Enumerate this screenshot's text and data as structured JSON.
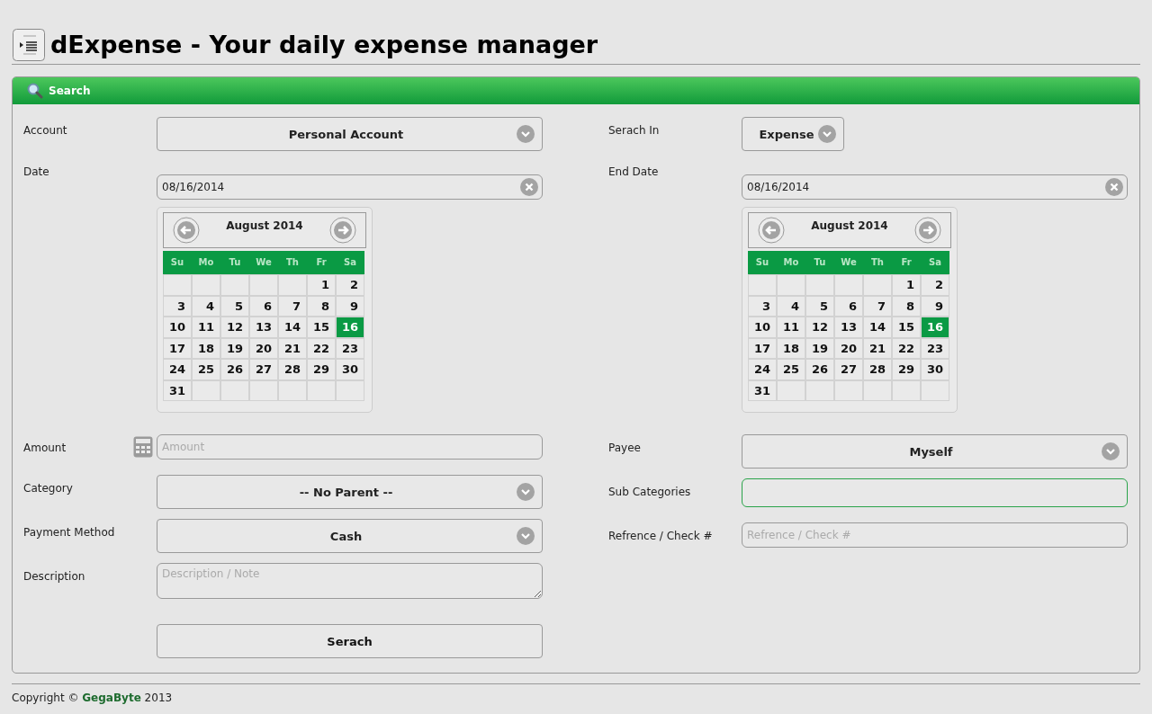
{
  "app": {
    "title": "dExpense - Your daily expense manager"
  },
  "panel": {
    "title": "Search"
  },
  "columns": [
    {
      "fields": [
        {
          "kind": "select",
          "label": "Account",
          "value": "Personal Account",
          "compact": false
        },
        {
          "kind": "date",
          "label": "Date",
          "value": "08/16/2014",
          "calendar": {
            "month": "August 2014",
            "weekdays": [
              "Su",
              "Mo",
              "Tu",
              "We",
              "Th",
              "Fr",
              "Sa"
            ],
            "weeks": [
              [
                {
                  "kind": "blank"
                },
                {
                  "kind": "blank"
                },
                {
                  "kind": "blank"
                },
                {
                  "kind": "blank"
                },
                {
                  "kind": "blank"
                },
                {
                  "kind": "day",
                  "day": "1",
                  "selected": false
                },
                {
                  "kind": "day",
                  "day": "2",
                  "selected": false
                }
              ],
              [
                {
                  "kind": "day",
                  "day": "3",
                  "selected": false
                },
                {
                  "kind": "day",
                  "day": "4",
                  "selected": false
                },
                {
                  "kind": "day",
                  "day": "5",
                  "selected": false
                },
                {
                  "kind": "day",
                  "day": "6",
                  "selected": false
                },
                {
                  "kind": "day",
                  "day": "7",
                  "selected": false
                },
                {
                  "kind": "day",
                  "day": "8",
                  "selected": false
                },
                {
                  "kind": "day",
                  "day": "9",
                  "selected": false
                }
              ],
              [
                {
                  "kind": "day",
                  "day": "10",
                  "selected": false
                },
                {
                  "kind": "day",
                  "day": "11",
                  "selected": false
                },
                {
                  "kind": "day",
                  "day": "12",
                  "selected": false
                },
                {
                  "kind": "day",
                  "day": "13",
                  "selected": false
                },
                {
                  "kind": "day",
                  "day": "14",
                  "selected": false
                },
                {
                  "kind": "day",
                  "day": "15",
                  "selected": false
                },
                {
                  "kind": "day",
                  "day": "16",
                  "selected": true
                }
              ],
              [
                {
                  "kind": "day",
                  "day": "17",
                  "selected": false
                },
                {
                  "kind": "day",
                  "day": "18",
                  "selected": false
                },
                {
                  "kind": "day",
                  "day": "19",
                  "selected": false
                },
                {
                  "kind": "day",
                  "day": "20",
                  "selected": false
                },
                {
                  "kind": "day",
                  "day": "21",
                  "selected": false
                },
                {
                  "kind": "day",
                  "day": "22",
                  "selected": false
                },
                {
                  "kind": "day",
                  "day": "23",
                  "selected": false
                }
              ],
              [
                {
                  "kind": "day",
                  "day": "24",
                  "selected": false
                },
                {
                  "kind": "day",
                  "day": "25",
                  "selected": false
                },
                {
                  "kind": "day",
                  "day": "26",
                  "selected": false
                },
                {
                  "kind": "day",
                  "day": "27",
                  "selected": false
                },
                {
                  "kind": "day",
                  "day": "28",
                  "selected": false
                },
                {
                  "kind": "day",
                  "day": "29",
                  "selected": false
                },
                {
                  "kind": "day",
                  "day": "30",
                  "selected": false
                }
              ],
              [
                {
                  "kind": "day",
                  "day": "31",
                  "selected": false
                },
                {
                  "kind": "blank"
                },
                {
                  "kind": "blank"
                },
                {
                  "kind": "blank"
                },
                {
                  "kind": "blank"
                },
                {
                  "kind": "blank"
                },
                {
                  "kind": "blank"
                }
              ]
            ]
          }
        },
        {
          "kind": "calc-input",
          "label": "Amount",
          "placeholder": "Amount",
          "focused": false
        },
        {
          "kind": "select",
          "label": "Category",
          "value": "-- No Parent --",
          "compact": false
        },
        {
          "kind": "select",
          "label": "Payment Method",
          "value": "Cash",
          "compact": false
        },
        {
          "kind": "textarea",
          "label": "Description",
          "placeholder": "Description / Note"
        },
        {
          "kind": "button",
          "value": "Serach"
        }
      ]
    },
    {
      "fields": [
        {
          "kind": "select",
          "label": "Serach In",
          "value": "Expense",
          "compact": true
        },
        {
          "kind": "date",
          "label": "End Date",
          "value": "08/16/2014",
          "calendar": {
            "month": "August 2014",
            "weekdays": [
              "Su",
              "Mo",
              "Tu",
              "We",
              "Th",
              "Fr",
              "Sa"
            ],
            "weeks": [
              [
                {
                  "kind": "blank"
                },
                {
                  "kind": "blank"
                },
                {
                  "kind": "blank"
                },
                {
                  "kind": "blank"
                },
                {
                  "kind": "blank"
                },
                {
                  "kind": "day",
                  "day": "1",
                  "selected": false
                },
                {
                  "kind": "day",
                  "day": "2",
                  "selected": false
                }
              ],
              [
                {
                  "kind": "day",
                  "day": "3",
                  "selected": false
                },
                {
                  "kind": "day",
                  "day": "4",
                  "selected": false
                },
                {
                  "kind": "day",
                  "day": "5",
                  "selected": false
                },
                {
                  "kind": "day",
                  "day": "6",
                  "selected": false
                },
                {
                  "kind": "day",
                  "day": "7",
                  "selected": false
                },
                {
                  "kind": "day",
                  "day": "8",
                  "selected": false
                },
                {
                  "kind": "day",
                  "day": "9",
                  "selected": false
                }
              ],
              [
                {
                  "kind": "day",
                  "day": "10",
                  "selected": false
                },
                {
                  "kind": "day",
                  "day": "11",
                  "selected": false
                },
                {
                  "kind": "day",
                  "day": "12",
                  "selected": false
                },
                {
                  "kind": "day",
                  "day": "13",
                  "selected": false
                },
                {
                  "kind": "day",
                  "day": "14",
                  "selected": false
                },
                {
                  "kind": "day",
                  "day": "15",
                  "selected": false
                },
                {
                  "kind": "day",
                  "day": "16",
                  "selected": true
                }
              ],
              [
                {
                  "kind": "day",
                  "day": "17",
                  "selected": false
                },
                {
                  "kind": "day",
                  "day": "18",
                  "selected": false
                },
                {
                  "kind": "day",
                  "day": "19",
                  "selected": false
                },
                {
                  "kind": "day",
                  "day": "20",
                  "selected": false
                },
                {
                  "kind": "day",
                  "day": "21",
                  "selected": false
                },
                {
                  "kind": "day",
                  "day": "22",
                  "selected": false
                },
                {
                  "kind": "day",
                  "day": "23",
                  "selected": false
                }
              ],
              [
                {
                  "kind": "day",
                  "day": "24",
                  "selected": false
                },
                {
                  "kind": "day",
                  "day": "25",
                  "selected": false
                },
                {
                  "kind": "day",
                  "day": "26",
                  "selected": false
                },
                {
                  "kind": "day",
                  "day": "27",
                  "selected": false
                },
                {
                  "kind": "day",
                  "day": "28",
                  "selected": false
                },
                {
                  "kind": "day",
                  "day": "29",
                  "selected": false
                },
                {
                  "kind": "day",
                  "day": "30",
                  "selected": false
                }
              ],
              [
                {
                  "kind": "day",
                  "day": "31",
                  "selected": false
                },
                {
                  "kind": "blank"
                },
                {
                  "kind": "blank"
                },
                {
                  "kind": "blank"
                },
                {
                  "kind": "blank"
                },
                {
                  "kind": "blank"
                },
                {
                  "kind": "blank"
                }
              ]
            ]
          }
        },
        {
          "kind": "select",
          "label": "Payee",
          "value": "Myself",
          "compact": false
        },
        {
          "kind": "input",
          "label": "Sub Categories",
          "focused": true
        },
        {
          "kind": "input",
          "label": "Refrence / Check #",
          "placeholder": "Refrence / Check #",
          "focused": false
        }
      ]
    }
  ],
  "footer": {
    "text": "Copyright © **GegaByte** 2013"
  }
}
